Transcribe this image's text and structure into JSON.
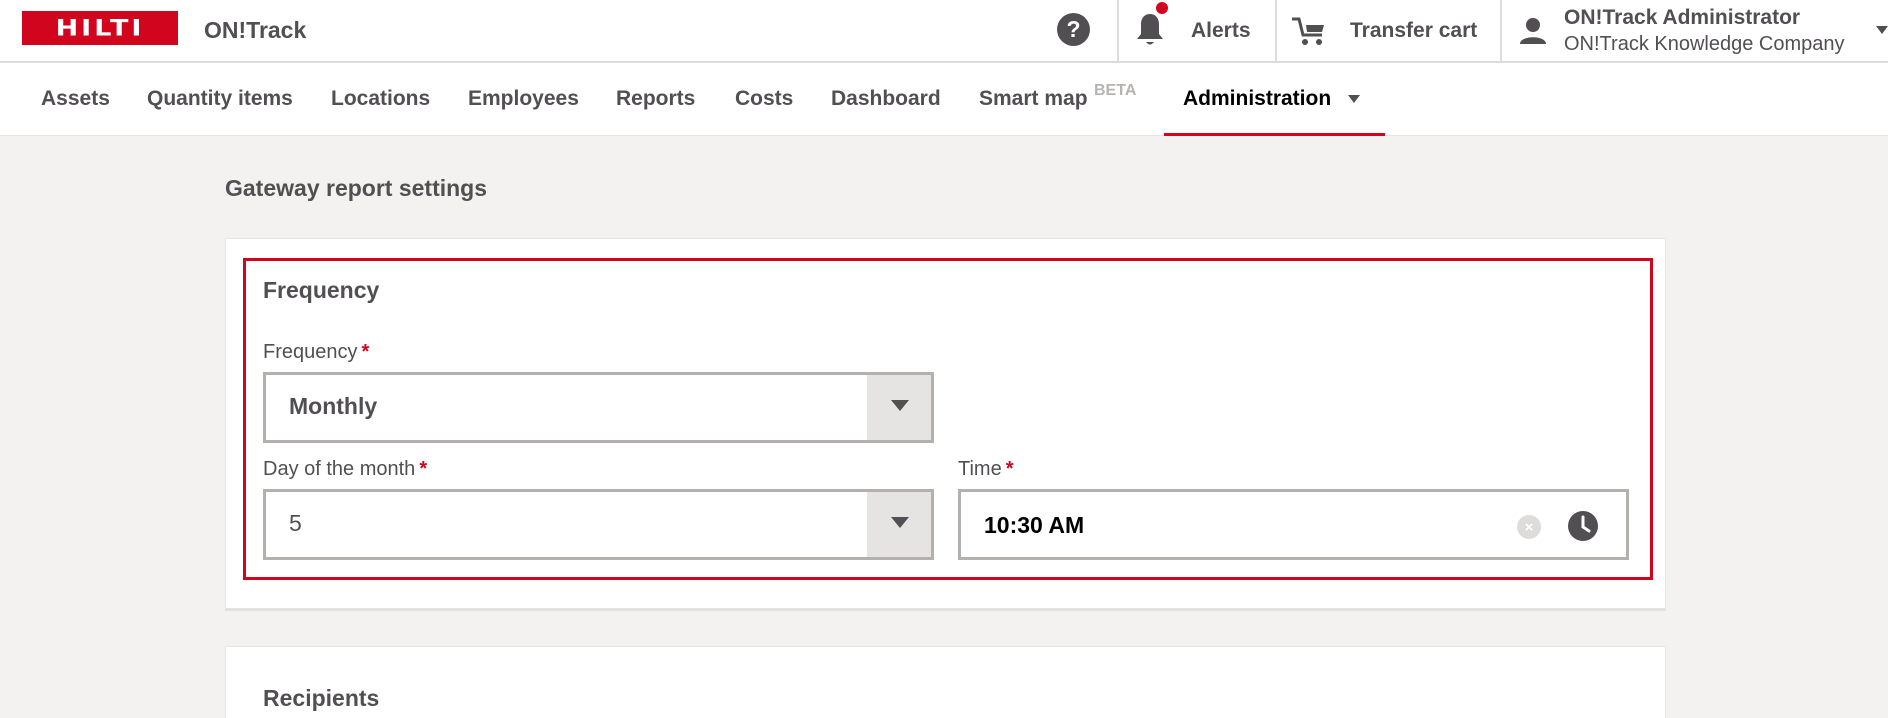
{
  "header": {
    "logo_text": "HILTI",
    "app_name": "ON!Track",
    "help_glyph": "?",
    "alerts_label": "Alerts",
    "transfer_cart_label": "Transfer cart",
    "user_name": "ON!Track Administrator",
    "user_company": "ON!Track Knowledge Company",
    "brand_color": "#d2051e",
    "icons": [
      "help-icon",
      "bell-icon",
      "cart-icon",
      "user-icon"
    ]
  },
  "nav": {
    "items": [
      "Assets",
      "Quantity items",
      "Locations",
      "Employees",
      "Reports",
      "Costs",
      "Dashboard",
      "Smart map",
      "Administration"
    ],
    "beta_badge": "BETA",
    "active": "Administration"
  },
  "page": {
    "title": "Gateway report settings",
    "frequency_section": {
      "title": "Frequency",
      "frequency_label": "Frequency",
      "frequency_value": "Monthly",
      "day_label": "Day of the month",
      "day_value": "5",
      "time_label": "Time",
      "time_value": "10:30 AM",
      "required_marker": "*"
    },
    "recipients_section": {
      "title": "Recipients"
    }
  }
}
